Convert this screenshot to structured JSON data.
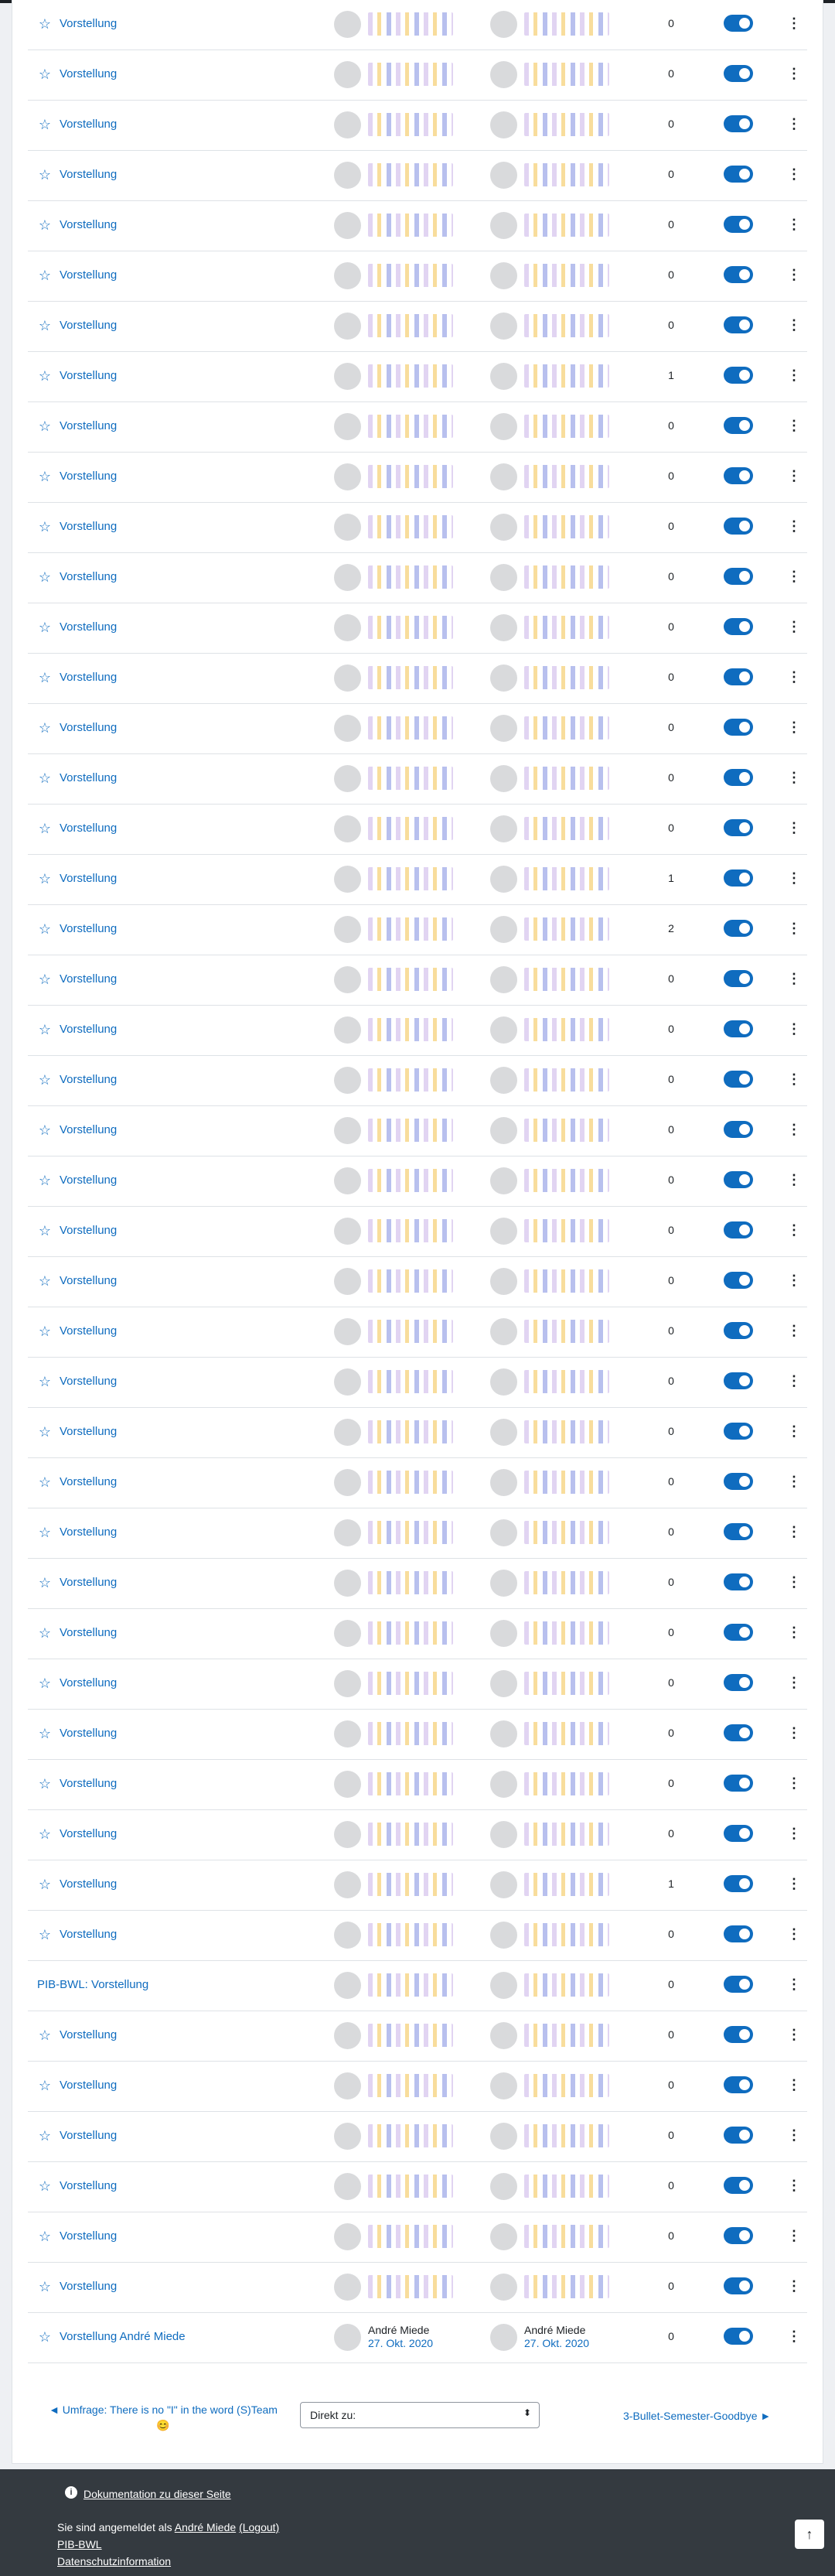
{
  "activities": [
    {
      "title": "Vorstellung",
      "level": 2,
      "count": "0"
    },
    {
      "title": "Vorstellung",
      "level": 2,
      "count": "0"
    },
    {
      "title": "Vorstellung",
      "level": 2,
      "count": "0"
    },
    {
      "title": "Vorstellung",
      "level": 2,
      "count": "0"
    },
    {
      "title": "Vorstellung",
      "level": 2,
      "count": "0"
    },
    {
      "title": "Vorstellung",
      "level": 2,
      "count": "0"
    },
    {
      "title": "Vorstellung",
      "level": 2,
      "count": "0"
    },
    {
      "title": "Vorstellung",
      "level": 2,
      "count": "1"
    },
    {
      "title": "Vorstellung",
      "level": 2,
      "count": "0"
    },
    {
      "title": "Vorstellung",
      "level": 2,
      "count": "0"
    },
    {
      "title": "Vorstellung",
      "level": 2,
      "count": "0"
    },
    {
      "title": "Vorstellung",
      "level": 2,
      "count": "0"
    },
    {
      "title": "Vorstellung",
      "level": 2,
      "count": "0"
    },
    {
      "title": "Vorstellung",
      "level": 2,
      "count": "0"
    },
    {
      "title": "Vorstellung",
      "level": 2,
      "count": "0"
    },
    {
      "title": "Vorstellung",
      "level": 2,
      "count": "0"
    },
    {
      "title": "Vorstellung",
      "level": 2,
      "count": "0"
    },
    {
      "title": "Vorstellung",
      "level": 2,
      "count": "1"
    },
    {
      "title": "Vorstellung",
      "level": 2,
      "count": "2"
    },
    {
      "title": "Vorstellung",
      "level": 2,
      "count": "0"
    },
    {
      "title": "Vorstellung",
      "level": 2,
      "count": "0"
    },
    {
      "title": "Vorstellung",
      "level": 2,
      "count": "0"
    },
    {
      "title": "Vorstellung",
      "level": 2,
      "count": "0"
    },
    {
      "title": "Vorstellung",
      "level": 2,
      "count": "0"
    },
    {
      "title": "Vorstellung",
      "level": 2,
      "count": "0"
    },
    {
      "title": "Vorstellung",
      "level": 2,
      "count": "0"
    },
    {
      "title": "Vorstellung",
      "level": 2,
      "count": "0"
    },
    {
      "title": "Vorstellung",
      "level": 2,
      "count": "0"
    },
    {
      "title": "Vorstellung",
      "level": 2,
      "count": "0"
    },
    {
      "title": "Vorstellung",
      "level": 2,
      "count": "0"
    },
    {
      "title": "Vorstellung",
      "level": 2,
      "count": "0"
    },
    {
      "title": "Vorstellung",
      "level": 2,
      "count": "0"
    },
    {
      "title": "Vorstellung",
      "level": 2,
      "count": "0"
    },
    {
      "title": "Vorstellung",
      "level": 2,
      "count": "0"
    },
    {
      "title": "Vorstellung",
      "level": 2,
      "count": "0"
    },
    {
      "title": "Vorstellung",
      "level": 2,
      "count": "0"
    },
    {
      "title": "Vorstellung",
      "level": 2,
      "count": "0"
    },
    {
      "title": "Vorstellung",
      "level": 2,
      "count": "1"
    },
    {
      "title": "Vorstellung",
      "level": 2,
      "count": "0"
    },
    {
      "title": "PIB-BWL: Vorstellung",
      "level": 1,
      "count": "0"
    },
    {
      "title": "Vorstellung",
      "level": 2,
      "count": "0"
    },
    {
      "title": "Vorstellung",
      "level": 2,
      "count": "0"
    },
    {
      "title": "Vorstellung",
      "level": 2,
      "count": "0"
    },
    {
      "title": "Vorstellung",
      "level": 2,
      "count": "0"
    },
    {
      "title": "Vorstellung",
      "level": 2,
      "count": "0"
    },
    {
      "title": "Vorstellung",
      "level": 2,
      "count": "0"
    },
    {
      "title": "Vorstellung André Miede",
      "level": 2,
      "count": "0",
      "author": "André Miede",
      "date": "27. Okt. 2020",
      "last_author": "André Miede",
      "last_date": "27. Okt. 2020"
    }
  ],
  "nav": {
    "prev_label": "◄ Umfrage: There is no \"I\" in the word (S)Team 😊",
    "jump_label": "Direkt zu:",
    "next_label": "3-Bullet-Semester-Goodbye ►"
  },
  "footer": {
    "doc_link": "Dokumentation zu dieser Seite",
    "logged_prefix": "Sie sind angemeldet als",
    "user_name": "André Miede",
    "logout": "(Logout)",
    "site": "PIB-BWL",
    "privacy": "Datenschutzinformation"
  },
  "colors": {
    "accent": "#0f6cbf",
    "footer_bg": "#343a40",
    "page_bg": "#eef0f3"
  }
}
